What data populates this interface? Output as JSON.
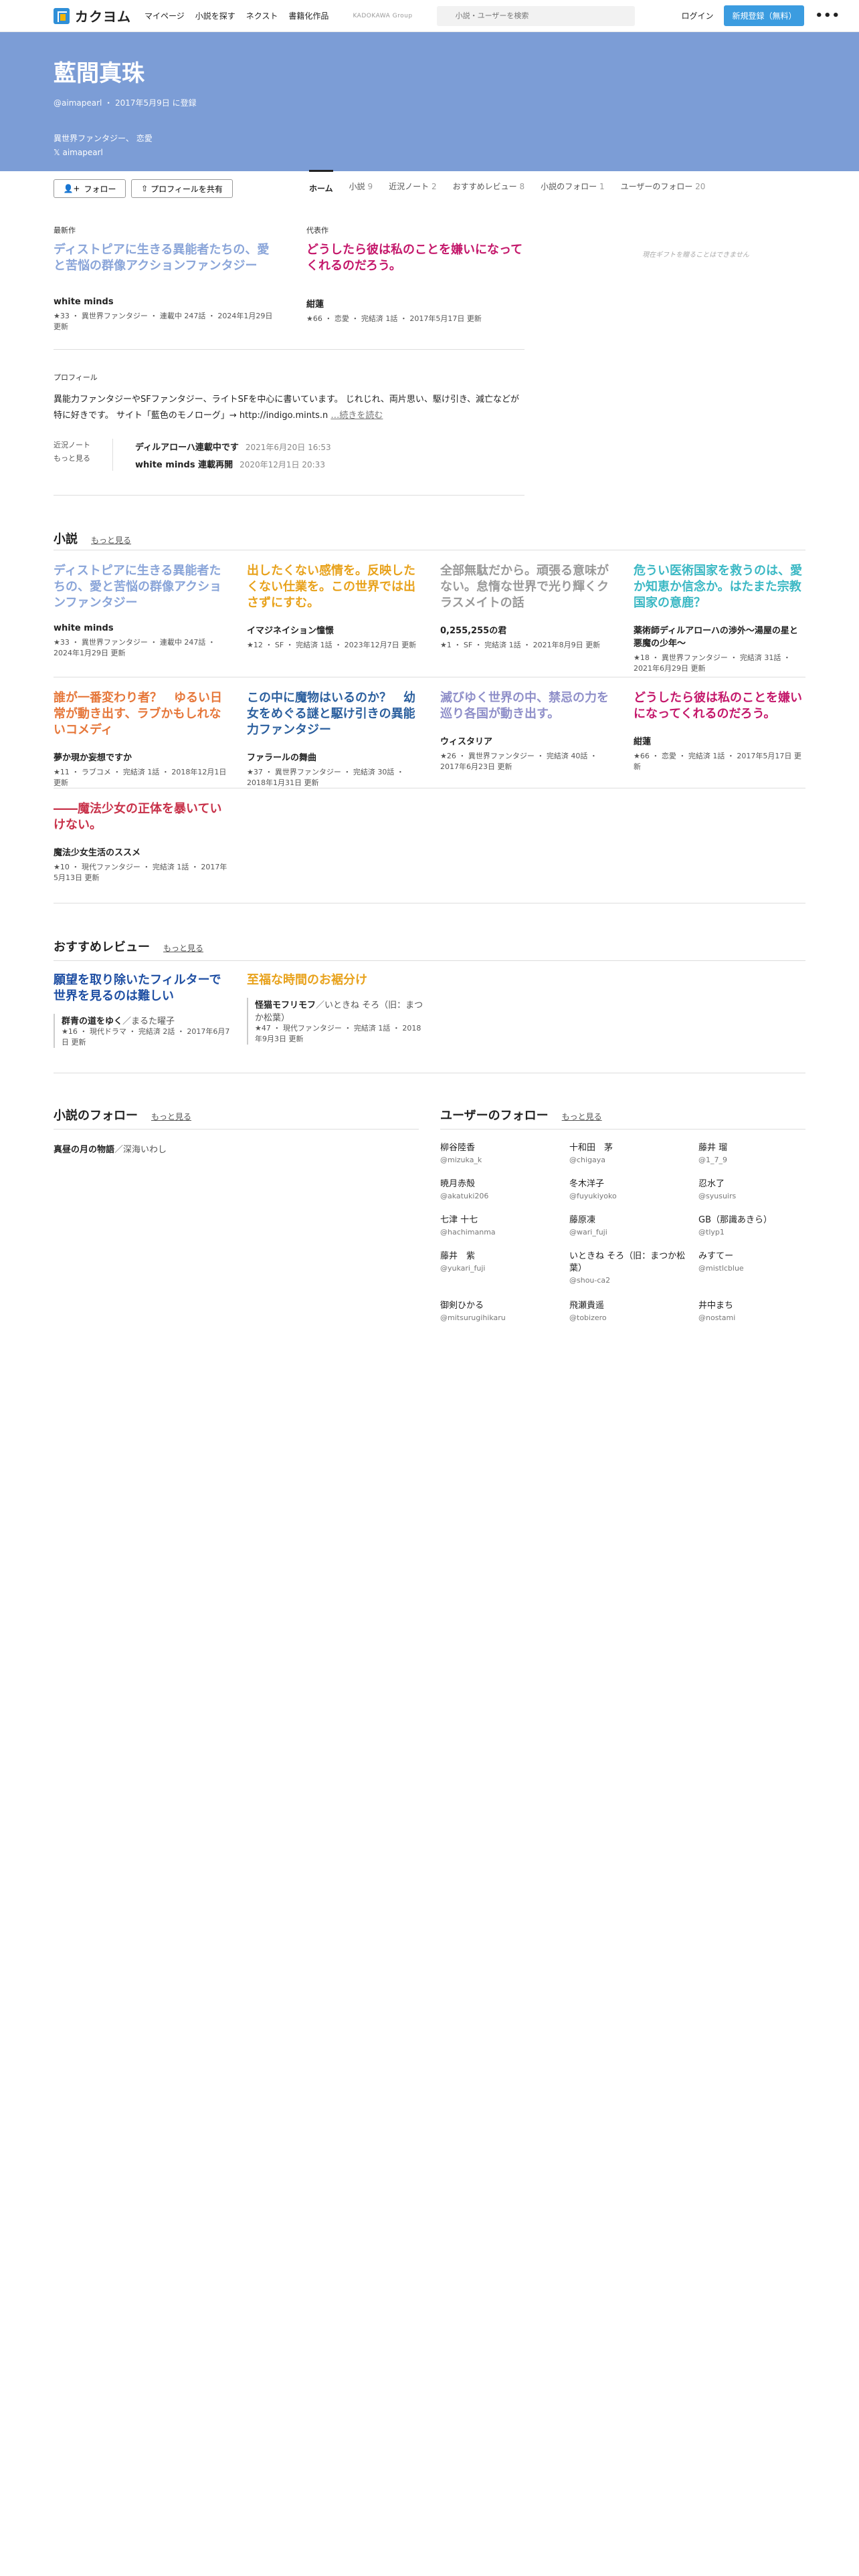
{
  "header": {
    "logo": "カクヨム",
    "nav": [
      "マイページ",
      "小説を探す",
      "ネクスト",
      "書籍化作品"
    ],
    "group": "KADOKAWA Group",
    "search_placeholder": "小説・ユーザーを検索",
    "login": "ログイン",
    "signup": "新規登録（無料）",
    "more": "•••"
  },
  "profile": {
    "name": "藍間真珠",
    "meta": "@aimapearl ・ 2017年5月9日 に登録",
    "genres": "異世界ファンタジー、 恋愛",
    "x_account": "𝕏 aimapearl"
  },
  "actions": {
    "follow": "フォロー",
    "share": "プロフィールを共有"
  },
  "tabs": [
    {
      "label": "ホーム",
      "count": ""
    },
    {
      "label": "小説",
      "count": "9"
    },
    {
      "label": "近況ノート",
      "count": "2"
    },
    {
      "label": "おすすめレビュー",
      "count": "8"
    },
    {
      "label": "小説のフォロー",
      "count": "1"
    },
    {
      "label": "ユーザーのフォロー",
      "count": "20"
    }
  ],
  "featured": {
    "latest": {
      "label": "最新作",
      "title": "ディストピアに生きる異能者たちの、愛と苦悩の群像アクションファンタジー",
      "author": "white minds",
      "meta": "★33 ・ 異世界ファンタジー ・ 連載中 247話 ・ 2024年1月29日 更新",
      "color": "#8aa5d9"
    },
    "representative": {
      "label": "代表作",
      "title": "どうしたら彼は私のことを嫌いになってくれるのだろう。",
      "author": "紺蓮",
      "meta": "★66 ・ 恋愛 ・ 完結済 1話 ・ 2017年5月17日 更新",
      "color": "#c4186b"
    },
    "gift_note": "現在ギフトを贈ることはできません"
  },
  "profile_section": {
    "label": "プロフィール",
    "text": "異能力ファンタジーやSFファンタジー、ライトSFを中心に書いています。 じれじれ、両片思い、駆け引き、減亡などが特に好きです。 サイト「藍色のモノローグ」→ http://indigo.mints.n",
    "more": "…続きを読む"
  },
  "notes": {
    "label": "近況ノート",
    "more": "もっと見る",
    "items": [
      {
        "title": "ディルアローハ連載中です",
        "date": "2021年6月20日 16:53"
      },
      {
        "title": "white minds 連載再開",
        "date": "2020年12月1日 20:33"
      }
    ]
  },
  "novels_section": {
    "title": "小説",
    "more": "もっと見る",
    "items": [
      {
        "title": "ディストピアに生きる異能者たちの、愛と苦悩の群像アクションファンタジー",
        "author": "white minds",
        "meta": "★33 ・ 異世界ファンタジー ・ 連載中 247話 ・ 2024年1月29日 更新",
        "color": "#8aa5d9"
      },
      {
        "title": "出したくない感情を。反映したくない仕業を。この世界では出さずにすむ。",
        "author": "イマジネイション憧憬",
        "meta": "★12 ・ SF ・ 完結済 1話 ・ 2023年12月7日 更新",
        "color": "#e8a21c"
      },
      {
        "title": "全部無駄だから。頑張る意味がない。怠惰な世界で光り輝くクラスメイトの話",
        "author": "0,255,255の君",
        "meta": "★1 ・ SF ・ 完結済 1話 ・ 2021年8月9日 更新",
        "color": "#9a9a9a"
      },
      {
        "title": "危うい医術国家を救うのは、愛か知恵か信念か。はたまた宗教国家の意鹿？",
        "author": "薬術師ディルアローハの渉外〜湯屋の星と悪魔の少年〜",
        "meta": "★18 ・ 異世界ファンタジー ・ 完結済 31話 ・ 2021年6月29日 更新",
        "color": "#3bb8c4"
      },
      {
        "title": "誰が一番変わり者？　ゆるい日常が動き出す、ラブかもしれないコメディ",
        "author": "夢か現か妄想ですか",
        "meta": "★11 ・ ラブコメ ・ 完結済 1話 ・ 2018年12月1日 更新",
        "color": "#e6773a"
      },
      {
        "title": "この中に魔物はいるのか？　幼女をめぐる謎と駆け引きの異能力ファンタジー",
        "author": "ファラールの舞曲",
        "meta": "★37 ・ 異世界ファンタジー ・ 完結済 30話 ・ 2018年1月31日 更新",
        "color": "#2b5f9e"
      },
      {
        "title": "滅びゆく世界の中、禁忌の力を巡り各国が動き出す。",
        "author": "ウィスタリア",
        "meta": "★26 ・ 異世界ファンタジー ・ 完結済 40話 ・ 2017年6月23日 更新",
        "color": "#8f8fc9"
      },
      {
        "title": "どうしたら彼は私のことを嫌いになってくれるのだろう。",
        "author": "紺蓮",
        "meta": "★66 ・ 恋愛 ・ 完結済 1話 ・ 2017年5月17日 更新",
        "color": "#c4186b"
      },
      {
        "title": "――魔法少女の正体を暴いていけない。",
        "author": "魔法少女生活のススメ",
        "meta": "★10 ・ 現代ファンタジー ・ 完結済 1話 ・ 2017年5月13日 更新",
        "color": "#c8324a"
      }
    ]
  },
  "reviews_section": {
    "title": "おすすめレビュー",
    "more": "もっと見る",
    "items": [
      {
        "title": "願望を取り除いたフィルターで世界を見るのは難しい",
        "work": "群青の道をゆく",
        "author": "／まるた曜子",
        "meta": "★16 ・ 現代ドラマ ・ 完結済 2話 ・ 2017年6月7日 更新",
        "color": "#1f4fa3"
      },
      {
        "title": "至福な時間のお裾分け",
        "work": "怪猫モフリモフ",
        "author": "／いときね そろ（旧：まつか松葉）",
        "meta": "★47 ・ 現代ファンタジー ・ 完結済 1話 ・ 2018年9月3日 更新",
        "color": "#e8a21c"
      }
    ]
  },
  "novel_follows": {
    "title": "小説のフォロー",
    "more": "もっと見る",
    "items": [
      {
        "work": "真昼の月の物語",
        "author": "／深海いわし"
      }
    ]
  },
  "user_follows": {
    "title": "ユーザーのフォロー",
    "more": "もっと見る",
    "items": [
      {
        "name": "柳谷陸香",
        "id": "@mizuka_k"
      },
      {
        "name": "十和田　茅",
        "id": "@chigaya"
      },
      {
        "name": "藤井 瑠",
        "id": "@1_7_9"
      },
      {
        "name": "暁月赤殻",
        "id": "@akatuki206"
      },
      {
        "name": "冬木洋子",
        "id": "@fuyukiyoko"
      },
      {
        "name": "忍水了",
        "id": "@syusuirs"
      },
      {
        "name": "七津 十七",
        "id": "@hachimanma"
      },
      {
        "name": "藤原凍",
        "id": "@wari_fuji"
      },
      {
        "name": "GB（那識あきら）",
        "id": "@tlyp1"
      },
      {
        "name": "藤井　紫",
        "id": "@yukari_fuji"
      },
      {
        "name": "いときね そろ（旧：まつか松葉）",
        "id": "@shou-ca2"
      },
      {
        "name": "みすてー",
        "id": "@mistlcblue"
      },
      {
        "name": "御剣ひかる",
        "id": "@mitsurugihikaru"
      },
      {
        "name": "飛瀬貴遥",
        "id": "@tobizero"
      },
      {
        "name": "井中まち",
        "id": "@nostami"
      }
    ]
  }
}
